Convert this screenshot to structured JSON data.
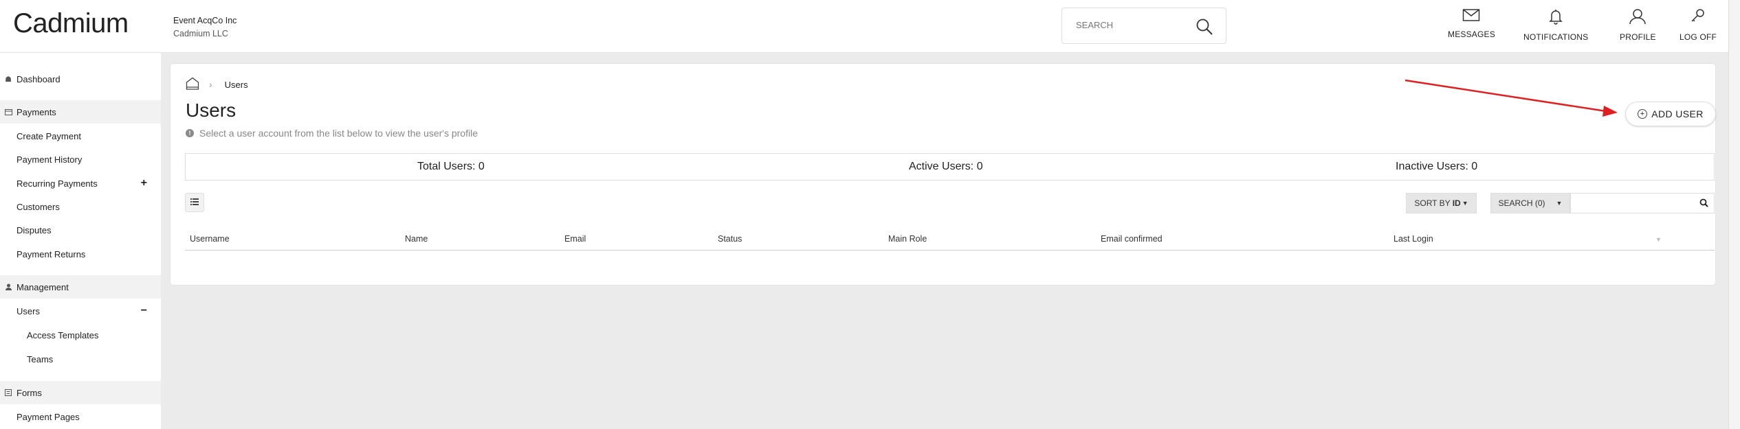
{
  "header": {
    "logo": "Cadmium",
    "org_name": "Event AcqCo Inc",
    "org_sub": "Cadmium LLC",
    "search_placeholder": "SEARCH",
    "nav": [
      {
        "label": "MESSAGES",
        "icon": "envelope-icon"
      },
      {
        "label": "NOTIFICATIONS",
        "icon": "bell-icon"
      },
      {
        "label": "PROFILE",
        "icon": "user-icon"
      },
      {
        "label": "LOG OFF",
        "icon": "key-icon"
      }
    ]
  },
  "sidebar": {
    "items": [
      {
        "label": "Dashboard",
        "type": "section-plain",
        "icon": "dashboard-icon"
      },
      {
        "label": "Payments",
        "type": "section",
        "icon": "card-icon"
      },
      {
        "label": "Create Payment",
        "type": "child"
      },
      {
        "label": "Payment History",
        "type": "child"
      },
      {
        "label": "Recurring Payments",
        "type": "child",
        "toggle": "+"
      },
      {
        "label": "Customers",
        "type": "child"
      },
      {
        "label": "Disputes",
        "type": "child"
      },
      {
        "label": "Payment Returns",
        "type": "child"
      },
      {
        "label": "Management",
        "type": "section",
        "icon": "person-icon"
      },
      {
        "label": "Users",
        "type": "child",
        "toggle": "−",
        "active": true
      },
      {
        "label": "Access Templates",
        "type": "grandchild"
      },
      {
        "label": "Teams",
        "type": "grandchild"
      },
      {
        "label": "Forms",
        "type": "section",
        "icon": "form-icon"
      },
      {
        "label": "Payment Pages",
        "type": "child"
      }
    ]
  },
  "main": {
    "breadcrumb_current": "Users",
    "title": "Users",
    "hint": "Select a user account from the list below to view the user's profile",
    "add_user_label": "ADD USER",
    "stats": {
      "total": "Total Users: 0",
      "active": "Active Users: 0",
      "inactive": "Inactive Users: 0"
    },
    "sort_label_prefix": "SORT BY ",
    "sort_label_value": "ID",
    "search_dropdown_label": "SEARCH (0)",
    "columns": [
      "Username",
      "Name",
      "Email",
      "Status",
      "Main Role",
      "Email confirmed",
      "Last Login"
    ]
  },
  "colors": {
    "annotation_arrow": "#e02020",
    "section_bg": "#f2f2f2",
    "page_bg": "#ebebeb"
  }
}
